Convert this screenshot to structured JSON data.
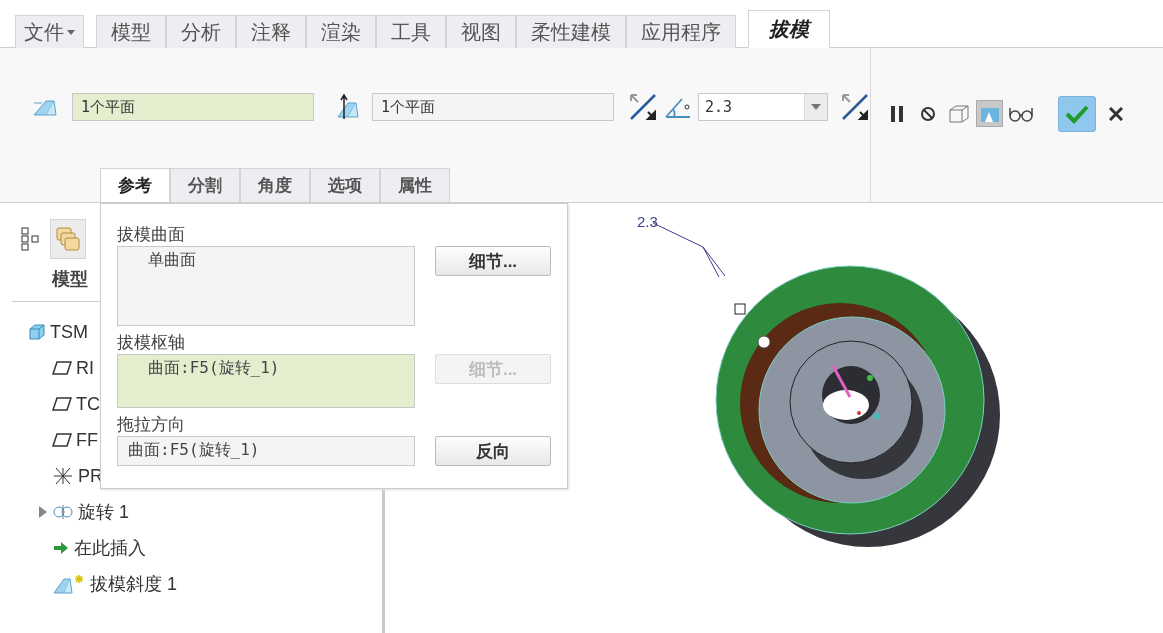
{
  "menu_tabs": [
    {
      "label": "文件",
      "kind": "file",
      "selected": false
    },
    {
      "label": "模型",
      "kind": "tab",
      "selected": false
    },
    {
      "label": "分析",
      "kind": "tab",
      "selected": false
    },
    {
      "label": "注释",
      "kind": "tab",
      "selected": false
    },
    {
      "label": "渲染",
      "kind": "tab",
      "selected": false
    },
    {
      "label": "工具",
      "kind": "tab",
      "selected": false
    },
    {
      "label": "视图",
      "kind": "tab",
      "selected": false
    },
    {
      "label": "柔性建模",
      "kind": "tab",
      "selected": false
    },
    {
      "label": "应用程序",
      "kind": "tab",
      "selected": false
    },
    {
      "label": "拔模",
      "kind": "tab",
      "selected": true
    }
  ],
  "ribbon": {
    "surfaces_field": {
      "value": "1个平面",
      "active": true
    },
    "hinge_field": {
      "value": "1个平面",
      "active": false
    },
    "angle_field": {
      "value": "2.3"
    },
    "tools": [
      {
        "kind": "pause",
        "selected": false
      },
      {
        "kind": "no-preview",
        "selected": false
      },
      {
        "kind": "wire-preview",
        "selected": false
      },
      {
        "kind": "shaded-preview",
        "selected": true
      },
      {
        "kind": "glasses",
        "selected": false
      }
    ],
    "sub_tabs": [
      {
        "label": "参考",
        "selected": true
      },
      {
        "label": "分割",
        "selected": false
      },
      {
        "label": "角度",
        "selected": false
      },
      {
        "label": "选项",
        "selected": false
      },
      {
        "label": "属性",
        "selected": false
      }
    ]
  },
  "references_panel": {
    "sections": [
      {
        "label": "拔模曲面",
        "kind": "list",
        "value": "单曲面",
        "active": false,
        "button": {
          "label": "细节...",
          "disabled": false
        }
      },
      {
        "label": "拔模枢轴",
        "kind": "list",
        "value": "曲面:F5(旋转_1)",
        "active": true,
        "button": {
          "label": "细节...",
          "disabled": true
        }
      },
      {
        "label": "拖拉方向",
        "kind": "field",
        "value": "曲面:F5(旋转_1)",
        "active": false,
        "button": {
          "label": "反向",
          "disabled": false
        }
      }
    ]
  },
  "model_tree": {
    "heading": "模型",
    "items": [
      {
        "label": "TSM",
        "kind": "part"
      },
      {
        "label": "RI",
        "kind": "plane"
      },
      {
        "label": "TC",
        "kind": "plane"
      },
      {
        "label": "FF",
        "kind": "plane"
      },
      {
        "label": "PR",
        "kind": "csys"
      },
      {
        "label": "旋转 1",
        "kind": "revolve",
        "expanded": false
      },
      {
        "label": "在此插入",
        "kind": "insert"
      },
      {
        "label": "拔模斜度 1",
        "kind": "draft"
      }
    ]
  },
  "viewport": {
    "dimension_label": "2.3"
  }
}
